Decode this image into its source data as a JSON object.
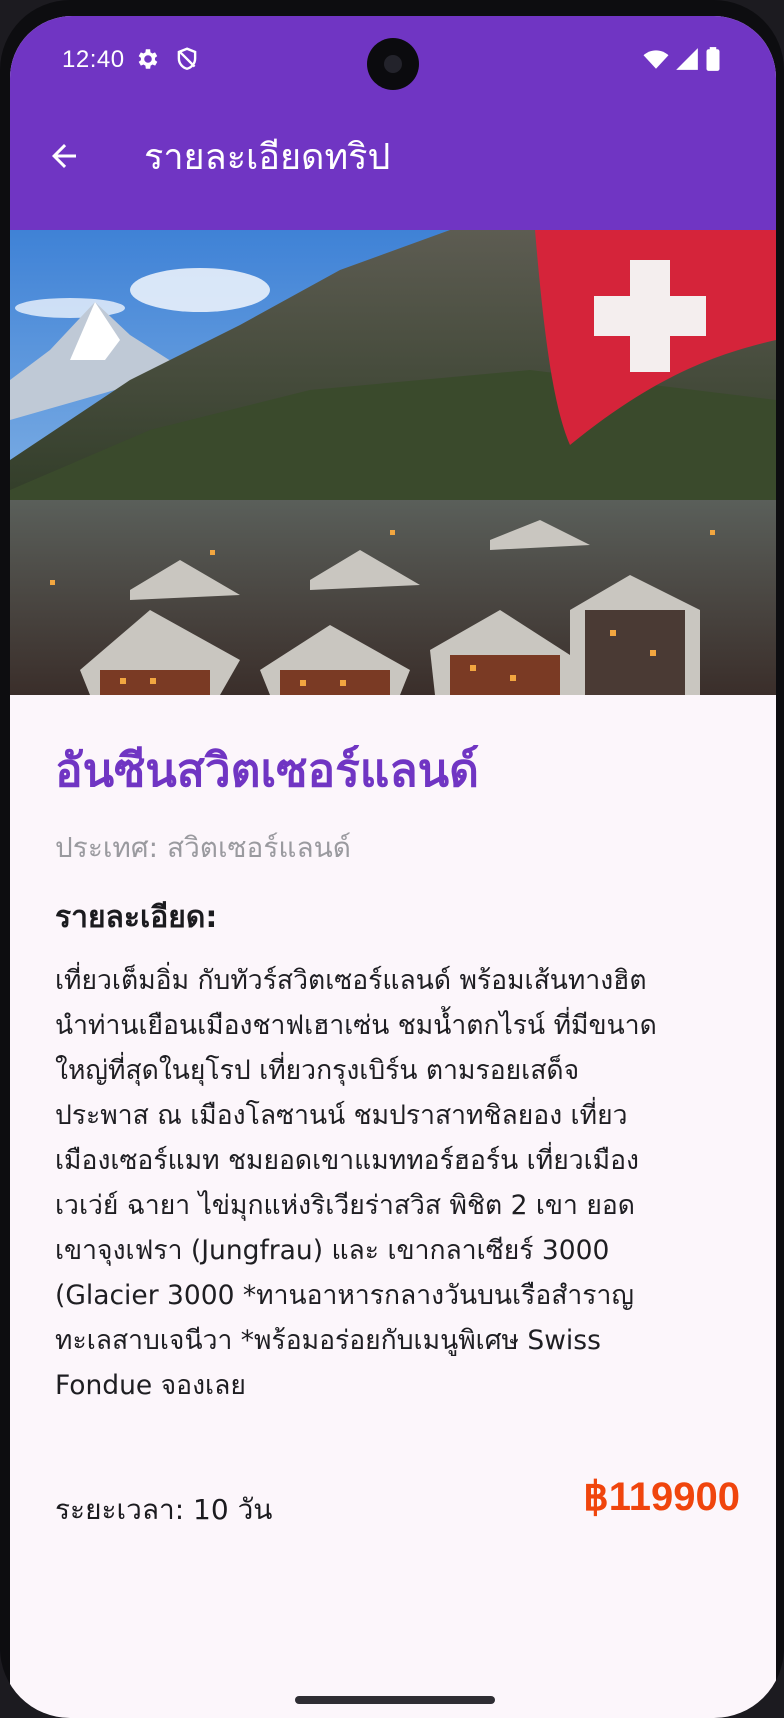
{
  "status_bar": {
    "time": "12:40",
    "left_icons": [
      "settings-gear-icon",
      "shield-icon"
    ],
    "right_icons": [
      "wifi-icon",
      "signal-icon",
      "battery-icon"
    ]
  },
  "app_bar": {
    "back_icon": "arrow-back-icon",
    "title": "รายละเอียดทริป",
    "background_color": "#7035c3"
  },
  "hero_image": {
    "subject": "Swiss alpine village with Matterhorn peak and Swiss flag"
  },
  "trip": {
    "name": "อันซีนสวิตเซอร์แลนด์",
    "country": "ประเทศ: สวิตเซอร์แลนด์",
    "details_heading": "รายละเอียด:",
    "description": "เที่ยวเต็มอิ่ม กับทัวร์สวิตเซอร์แลนด์ พร้อมเส้นทางฮิต\nนำท่านเยือนเมืองชาฟเฮาเซ่น ชมน้ำตกไรน์ ที่มีขนาด\nใหญ่ที่สุดในยุโรป เที่ยวกรุงเบิร์น ตามรอยเสด็จ\nประพาส ณ เมืองโลซานน์ ชมปราสาทชิลยอง เที่ยว\nเมืองเซอร์แมท ชมยอดเขาแมททอร์ฮอร์น เที่ยวเมือง\nเวเว่ย์ ฉายา ไข่มุกแห่งริเวียร่าสวิส พิชิต 2 เขา ยอด\nเขาจุงเฟรา (Jungfrau) และ เขากลาเซียร์ 3000\n(Glacier 3000 *ทานอาหารกลางวันบนเรือสำราญ\nทะเลสาบเจนีวา *พร้อมอร่อยกับเมนูพิเศษ Swiss\nFondue จองเลย",
    "duration_label": "ระยะเวลา:",
    "duration_value": "10 วัน",
    "price": "฿119900",
    "name_color": "#7035c3",
    "price_color": "#f0450d"
  }
}
